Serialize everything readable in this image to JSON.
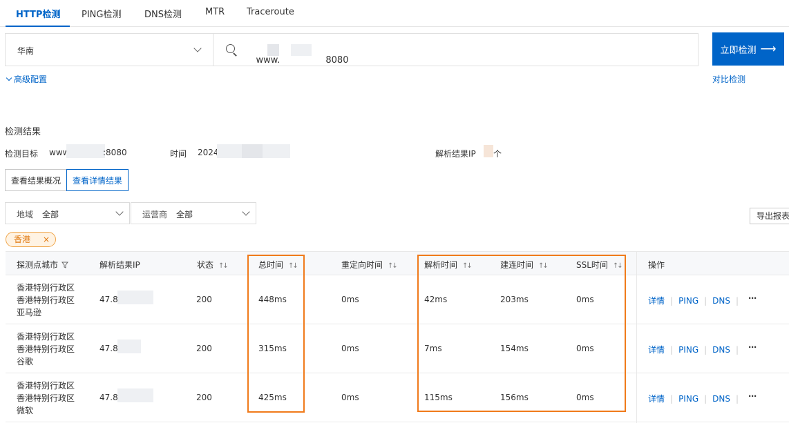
{
  "tabs": [
    "HTTP检测",
    "PING检测",
    "DNS检测",
    "MTR",
    "Traceroute"
  ],
  "search": {
    "region": "华南",
    "url_prefix": "www.",
    "url_suffix": "8080",
    "submit_label": "立即检测",
    "submit_arrow": "⟶"
  },
  "advanced_config": "高级配置",
  "compare_check": "对比检测",
  "results": {
    "title": "检测结果",
    "target_label": "检测目标",
    "target_prefix": "www",
    "target_suffix": ":8080",
    "time_label": "时间",
    "time_prefix": "2024",
    "ip_label": "解析结果IP",
    "ip_suffix": "个",
    "view_overview": "查看结果概况",
    "view_details": "查看详情结果"
  },
  "filters": {
    "region_label": "地域",
    "region_value": "全部",
    "isp_label": "运营商",
    "isp_value": "全部",
    "export_label": "导出报表"
  },
  "active_tag": "香港",
  "active_tag_close": "×",
  "table": {
    "headers": {
      "city": "探测点城市",
      "ip": "解析结果IP",
      "status": "状态",
      "total": "总时间",
      "redirect": "重定向时间",
      "dns": "解析时间",
      "connect": "建连时间",
      "ssl": "SSL时间",
      "ops": "操作"
    },
    "rows": [
      {
        "city1": "香港特别行政区",
        "city2": "香港特别行政区",
        "isp": "亚马逊",
        "ip": "47.89",
        "status": "200",
        "total": "448ms",
        "redirect": "0ms",
        "dns": "42ms",
        "connect": "203ms",
        "ssl": "0ms"
      },
      {
        "city1": "香港特别行政区",
        "city2": "香港特别行政区",
        "isp": "谷歌",
        "ip": "47.88",
        "status": "200",
        "total": "315ms",
        "redirect": "0ms",
        "dns": "7ms",
        "connect": "154ms",
        "ssl": "0ms"
      },
      {
        "city1": "香港特别行政区",
        "city2": "香港特别行政区",
        "isp": "微软",
        "ip": "47.89",
        "status": "200",
        "total": "425ms",
        "redirect": "0ms",
        "dns": "115ms",
        "connect": "156ms",
        "ssl": "0ms"
      }
    ],
    "op_labels": {
      "detail": "详情",
      "ping": "PING",
      "dns": "DNS",
      "more": "⋯"
    }
  },
  "colors": {
    "primary": "#0064c8",
    "highlight": "#f07a1a",
    "tag_bg": "#fff3e3"
  }
}
